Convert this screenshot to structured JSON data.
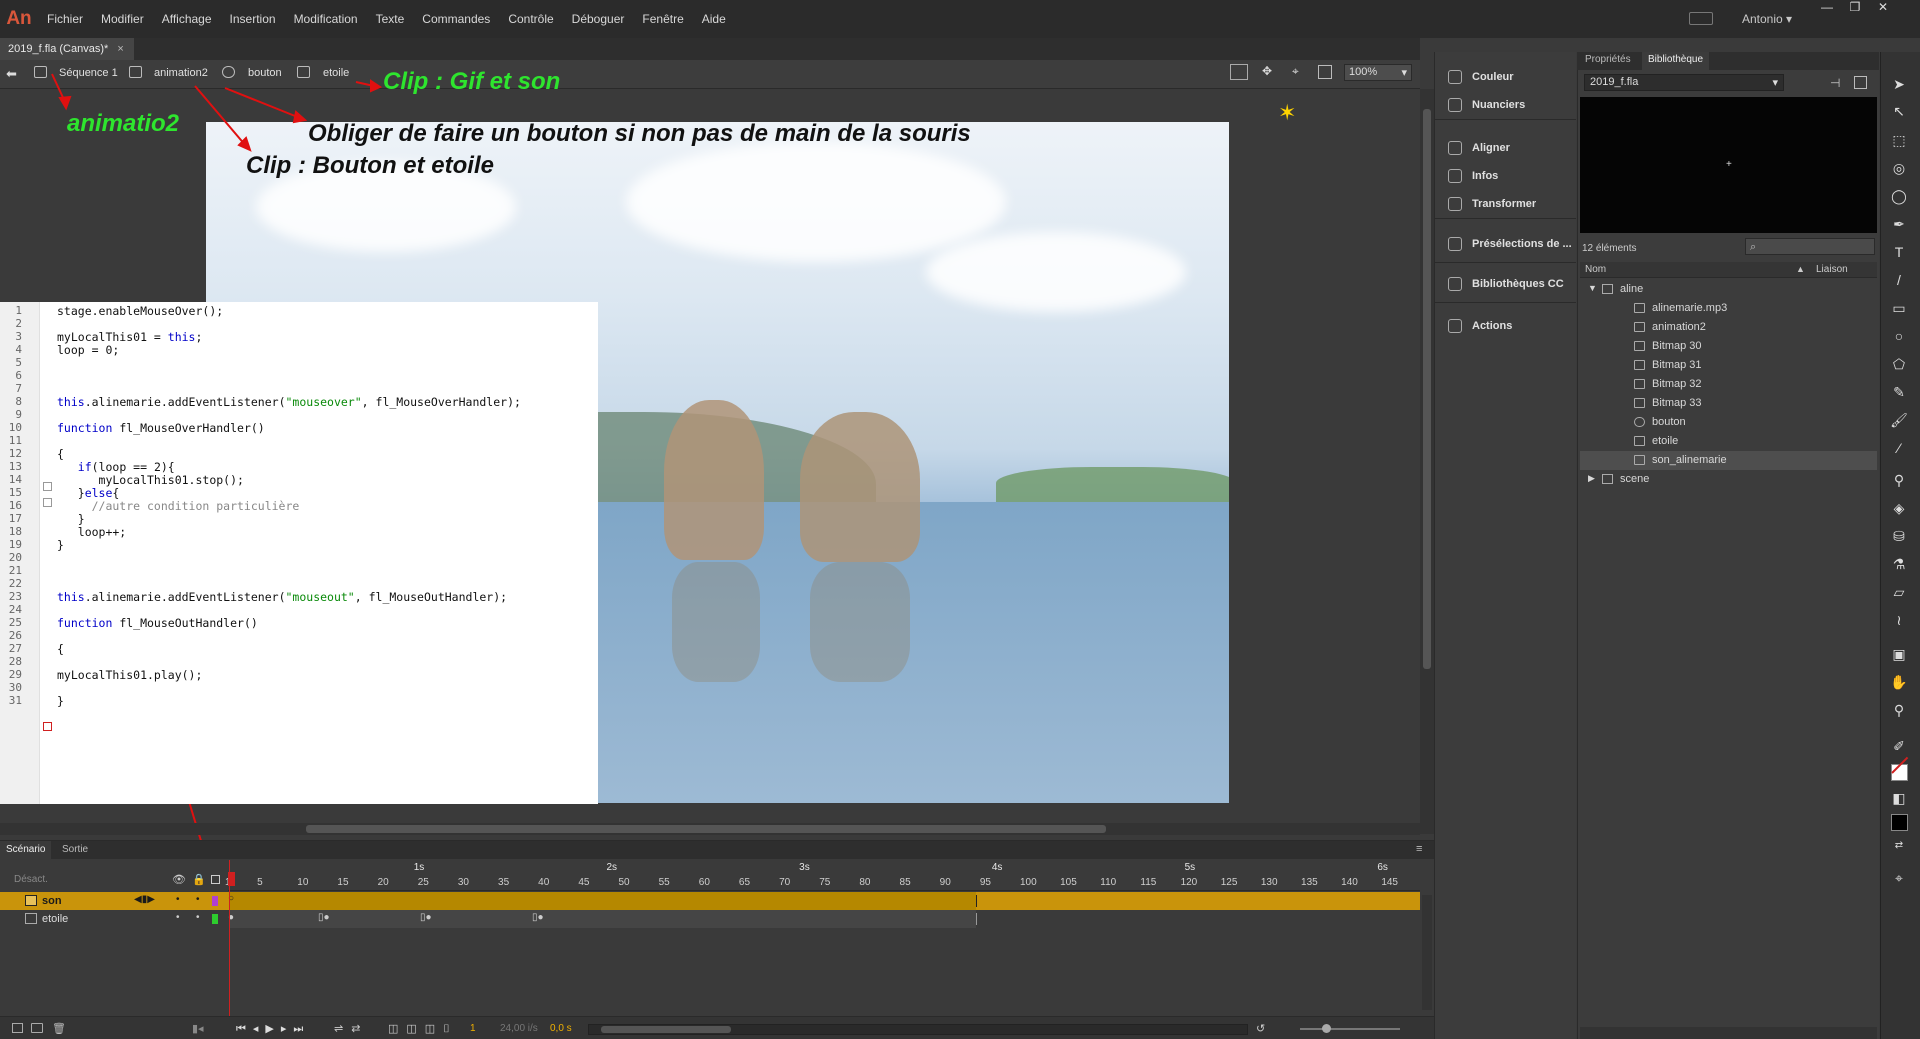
{
  "app": {
    "logo": "An",
    "menus": [
      "Fichier",
      "Modifier",
      "Affichage",
      "Insertion",
      "Modification",
      "Texte",
      "Commandes",
      "Contrôle",
      "Déboguer",
      "Fenêtre",
      "Aide"
    ],
    "user": "Antonio"
  },
  "doc_tab": {
    "label": "2019_f.fla (Canvas)*",
    "close": "×"
  },
  "breadcrumb": [
    "Séquence 1",
    "animation2",
    "bouton",
    "etoile"
  ],
  "zoom": "100%",
  "annotations": {
    "gif_son": "Clip : Gif et son",
    "animatio2": "animatio2",
    "obliger": "Obliger de faire un bouton si non pas de main de la souris",
    "bouton_etoile": "Clip : Bouton et etoile"
  },
  "code": [
    {
      "n": "1",
      "t": "stage.enableMouseOver();"
    },
    {
      "n": "2",
      "t": ""
    },
    {
      "n": "3",
      "t": "myLocalThis01 = this;"
    },
    {
      "n": "4",
      "t": "loop = 0;"
    },
    {
      "n": "5",
      "t": ""
    },
    {
      "n": "6",
      "t": ""
    },
    {
      "n": "7",
      "t": ""
    },
    {
      "n": "8",
      "t": "this.alinemarie.addEventListener(\"mouseover\", fl_MouseOverHandler);"
    },
    {
      "n": "9",
      "t": ""
    },
    {
      "n": "10",
      "t": "function fl_MouseOverHandler()"
    },
    {
      "n": "11",
      "t": ""
    },
    {
      "n": "12",
      "t": "{"
    },
    {
      "n": "13",
      "t": "   if(loop == 2){"
    },
    {
      "n": "14",
      "t": "      myLocalThis01.stop();"
    },
    {
      "n": "15",
      "t": "   }else{"
    },
    {
      "n": "16",
      "t": "     //autre condition particulière"
    },
    {
      "n": "17",
      "t": "   }"
    },
    {
      "n": "18",
      "t": "   loop++;"
    },
    {
      "n": "19",
      "t": "}"
    },
    {
      "n": "20",
      "t": ""
    },
    {
      "n": "21",
      "t": ""
    },
    {
      "n": "22",
      "t": ""
    },
    {
      "n": "23",
      "t": "this.alinemarie.addEventListener(\"mouseout\", fl_MouseOutHandler);"
    },
    {
      "n": "24",
      "t": ""
    },
    {
      "n": "25",
      "t": "function fl_MouseOutHandler()"
    },
    {
      "n": "26",
      "t": ""
    },
    {
      "n": "27",
      "t": "{"
    },
    {
      "n": "28",
      "t": ""
    },
    {
      "n": "29",
      "t": "myLocalThis01.play();"
    },
    {
      "n": "30",
      "t": ""
    },
    {
      "n": "31",
      "t": "}"
    }
  ],
  "panels": [
    "Couleur",
    "Nuanciers",
    "Aligner",
    "Infos",
    "Transformer",
    "Présélections de ...",
    "Bibliothèques CC",
    "Actions"
  ],
  "library": {
    "tabs": [
      "Propriétés",
      "Bibliothèque"
    ],
    "file": "2019_f.fla",
    "count": "12 éléments",
    "col_name": "Nom",
    "col_link": "Liaison",
    "items": [
      {
        "label": "aline",
        "icon": "folder-open-icon",
        "indent": 0
      },
      {
        "label": "alinemarie.mp3",
        "icon": "sound-icon",
        "indent": 1
      },
      {
        "label": "animation2",
        "icon": "movieclip-icon",
        "indent": 1
      },
      {
        "label": "Bitmap 30",
        "icon": "bitmap-icon",
        "indent": 1
      },
      {
        "label": "Bitmap 31",
        "icon": "bitmap-icon",
        "indent": 1
      },
      {
        "label": "Bitmap 32",
        "icon": "bitmap-icon",
        "indent": 1
      },
      {
        "label": "Bitmap 33",
        "icon": "bitmap-icon",
        "indent": 1
      },
      {
        "label": "bouton",
        "icon": "button-icon",
        "indent": 1
      },
      {
        "label": "etoile",
        "icon": "movieclip-icon",
        "indent": 1
      },
      {
        "label": "son_alinemarie",
        "icon": "movieclip-icon",
        "indent": 1
      },
      {
        "label": "scene",
        "icon": "folder-icon",
        "indent": 0
      }
    ]
  },
  "timeline": {
    "tabs": [
      "Scénario",
      "Sortie"
    ],
    "disabled_label": "Désact.",
    "layers": [
      "son",
      "etoile"
    ],
    "ticks": [
      "1",
      "5",
      "10",
      "15",
      "20",
      "25",
      "30",
      "35",
      "40",
      "45",
      "50",
      "55",
      "60",
      "65",
      "70",
      "75",
      "80",
      "85",
      "90",
      "95",
      "100",
      "105",
      "110",
      "115",
      "120",
      "125",
      "130",
      "135",
      "140",
      "145"
    ],
    "seconds": [
      "1s",
      "2s",
      "3s",
      "4s",
      "5s",
      "6s"
    ],
    "frame": "1",
    "fps": "24,00 i/s",
    "time": "0,0 s"
  },
  "colors": {
    "accent": "#f0b000",
    "annotation_green": "#2ee52e",
    "arrow": "#e01010",
    "playhead": "#d02020"
  }
}
